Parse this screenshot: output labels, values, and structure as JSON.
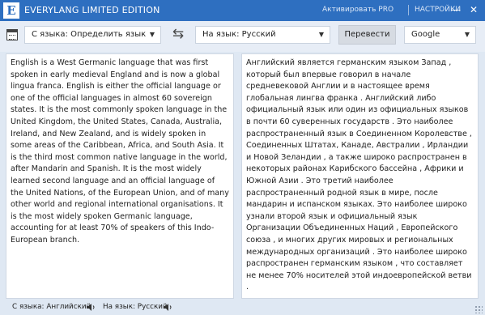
{
  "window": {
    "logo_letter": "E",
    "title": "EVERYLANG LIMITED EDITION",
    "activate_pro": "Активировать PRO",
    "settings": "НАСТРОЙКИ",
    "minimize": "—",
    "close": "✕"
  },
  "toolbar": {
    "from_lang": "С языка: Определить язык",
    "to_lang": "На язык: Русский",
    "translate_label": "Перевести",
    "engine": "Google",
    "swap_symbol": "⇆"
  },
  "source_text": "English is a West Germanic language that was first spoken in early medieval England and is now a global lingua franca. English is either the official language or one of the official languages in almost 60 sovereign states. It is the most commonly spoken language in the United Kingdom, the United States, Canada, Australia, Ireland, and New Zealand, and is widely spoken in some areas of the Caribbean, Africa, and South Asia. It is the third most common native language in the world, after Mandarin and Spanish. It is the most widely learned second language and an official language of the United Nations, of the European Union, and of many other world and regional international organisations. It is the most widely spoken Germanic language, accounting for at least 70% of speakers of this Indo-European branch.",
  "translated_text": "Английский является германским языком Запад , который был впервые говорил в начале средневековой Англии и в настоящее время глобальная лингва франка . Английский либо официальный язык или один из официальных языков в почти 60 суверенных государств . Это наиболее распространенный язык в Соединенном Королевстве , Соединенных Штатах, Канаде, Австралии , Ирландии и Новой Зеландии , а также широко распространен в некоторых районах Карибского бассейна , Африки и Южной Азии . Это третий наиболее распространенный родной язык в мире, после мандарин и испанском языках. Это наиболее широко узнали второй язык и официальный язык Организации Объединенных Наций , Европейского союза , и многих других мировых и региональных международных организаций . Это наиболее широко распространен германским языком , что составляет не менее 70% носителей этой индоевропейской ветви .",
  "status": {
    "from_label": "С языка: Английский",
    "to_label": "На язык: Русский"
  },
  "colors": {
    "titlebar": "#2e6fc0",
    "background": "#dfe8f3"
  }
}
